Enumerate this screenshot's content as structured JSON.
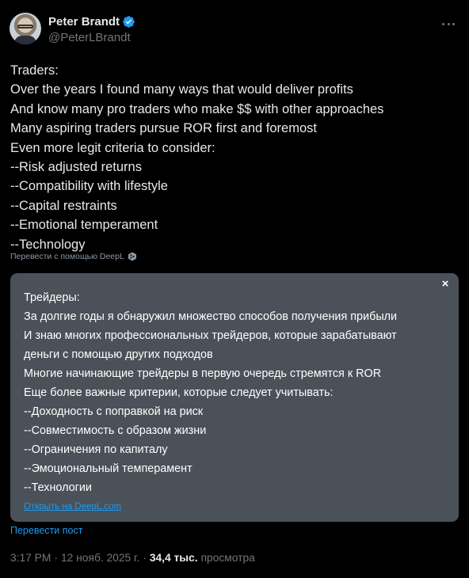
{
  "author": {
    "display_name": "Peter Brandt",
    "handle": "@PeterLBrandt",
    "verified": true
  },
  "tweet": {
    "lines": [
      "Traders:",
      "Over the years I found many ways that would deliver profits",
      "And know many pro traders who make $$ with other approaches",
      "Many aspiring traders pursue ROR first and foremost",
      "Even more legit criteria to consider:",
      "--Risk adjusted returns",
      "--Compatibility with lifestyle",
      "--Capital restraints",
      "--Emotional temperament",
      "--Technology"
    ]
  },
  "translate_with_deepl": "Перевести с помощью DeepL",
  "translation": {
    "lines": [
      "Трейдеры:",
      "За долгие годы я обнаружил множество способов получения прибыли",
      "И знаю многих профессиональных трейдеров, которые зарабатывают",
      "деньги с помощью других подходов",
      "Многие начинающие трейдеры в первую очередь стремятся к ROR",
      "Еще более важные критерии, которые следует учитывать:",
      "--Доходность с поправкой на риск",
      "--Совместимость с образом жизни",
      "--Ограничения по капиталу",
      "--Эмоциональный темперамент",
      "--Технологии"
    ],
    "close_label": "×",
    "open_link": "Открыть на DeepL.com"
  },
  "translate_post": "Перевести пост",
  "meta": {
    "time": "3:17 PM",
    "date": "12 нояб. 2025 г.",
    "separator": "·",
    "views_count": "34,4 тыс.",
    "views_label": "просмотра"
  },
  "colors": {
    "background": "#000000",
    "text": "#e7e9ea",
    "muted": "#71767b",
    "link": "#1d9bf0",
    "translation_bg": "#4a5158",
    "verified": "#1d9bf0"
  },
  "icons": [
    "verified-badge-icon",
    "more-options-icon",
    "deepl-logo-icon",
    "close-icon"
  ]
}
